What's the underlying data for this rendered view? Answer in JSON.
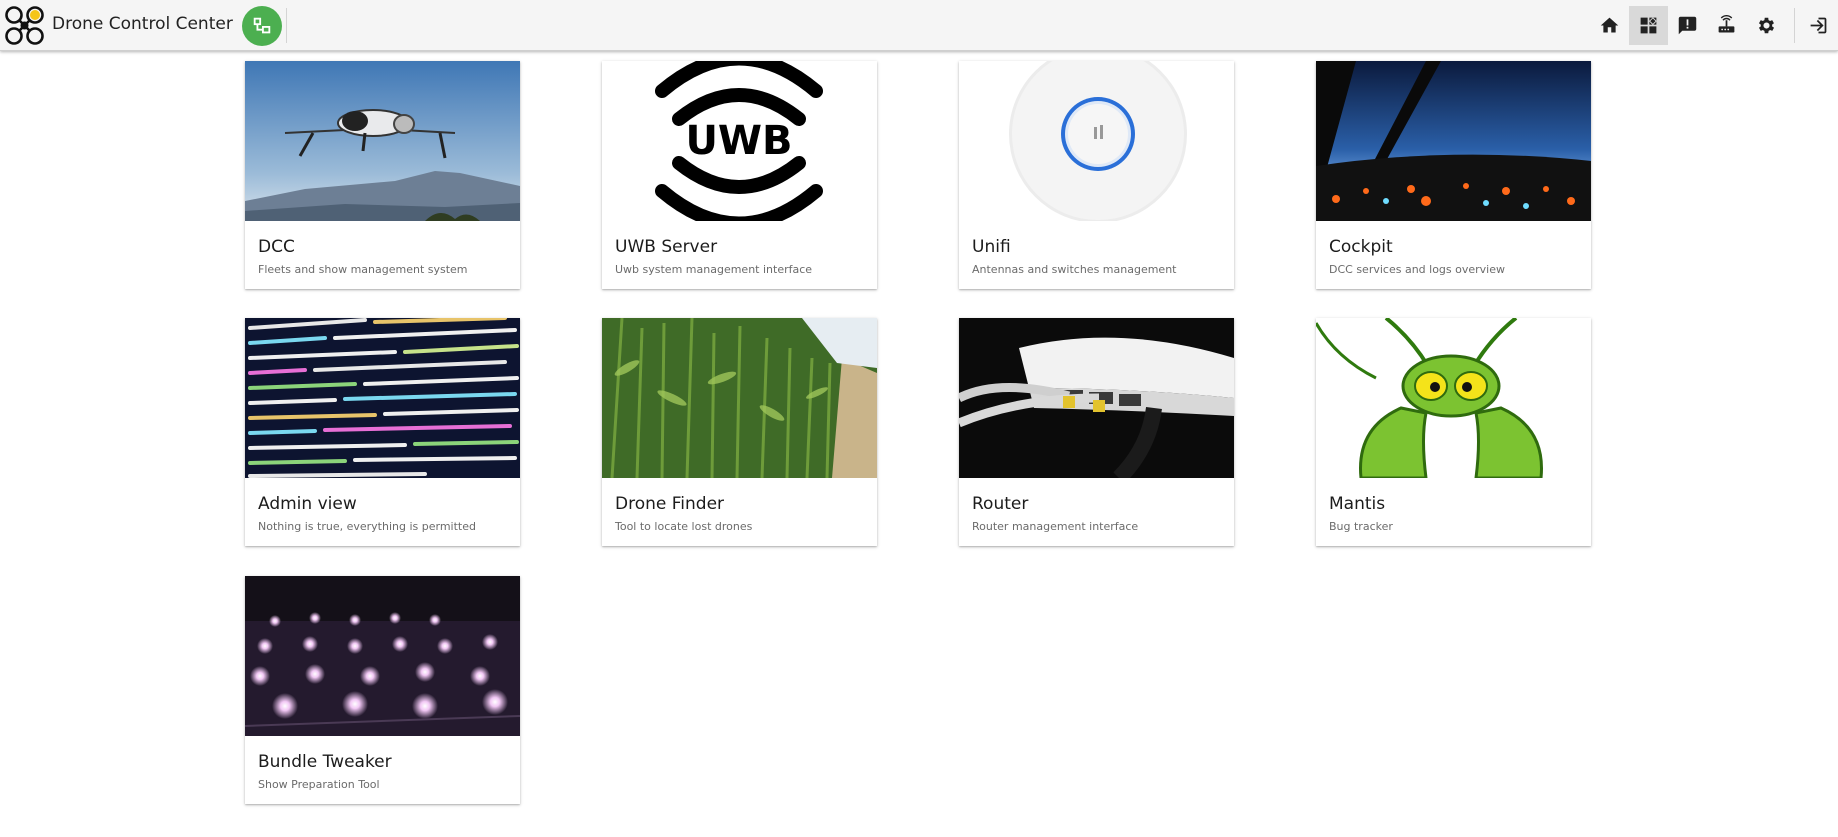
{
  "header": {
    "title": "Drone Control Center",
    "nav": [
      {
        "icon": "home-icon"
      },
      {
        "icon": "dashboard-icon",
        "active": true
      },
      {
        "icon": "feedback-icon"
      },
      {
        "icon": "router-icon"
      },
      {
        "icon": "settings-icon"
      },
      {
        "icon": "logout-icon"
      }
    ]
  },
  "apps": [
    {
      "title": "DCC",
      "subtitle": "Fleets and show management system",
      "image": "drone-photo"
    },
    {
      "title": "UWB Server",
      "subtitle": "Uwb system management interface",
      "image": "uwb-logo",
      "image_text": "UWB"
    },
    {
      "title": "Unifi",
      "subtitle": "Antennas and switches management",
      "image": "unifi-access-point"
    },
    {
      "title": "Cockpit",
      "subtitle": "DCC services and logs overview",
      "image": "cockpit-photo"
    },
    {
      "title": "Admin view",
      "subtitle": "Nothing is true, everything is permitted",
      "image": "code-screen-photo"
    },
    {
      "title": "Drone Finder",
      "subtitle": "Tool to locate lost drones",
      "image": "cornfield-photo"
    },
    {
      "title": "Router",
      "subtitle": "Router management interface",
      "image": "router-photo"
    },
    {
      "title": "Mantis",
      "subtitle": "Bug tracker",
      "image": "mantis-logo"
    },
    {
      "title": "Bundle Tweaker",
      "subtitle": "Show Preparation Tool",
      "image": "drone-swarm-photo"
    }
  ],
  "colors": {
    "accent_green": "#4caf50",
    "topbar": "#f5f5f5"
  }
}
